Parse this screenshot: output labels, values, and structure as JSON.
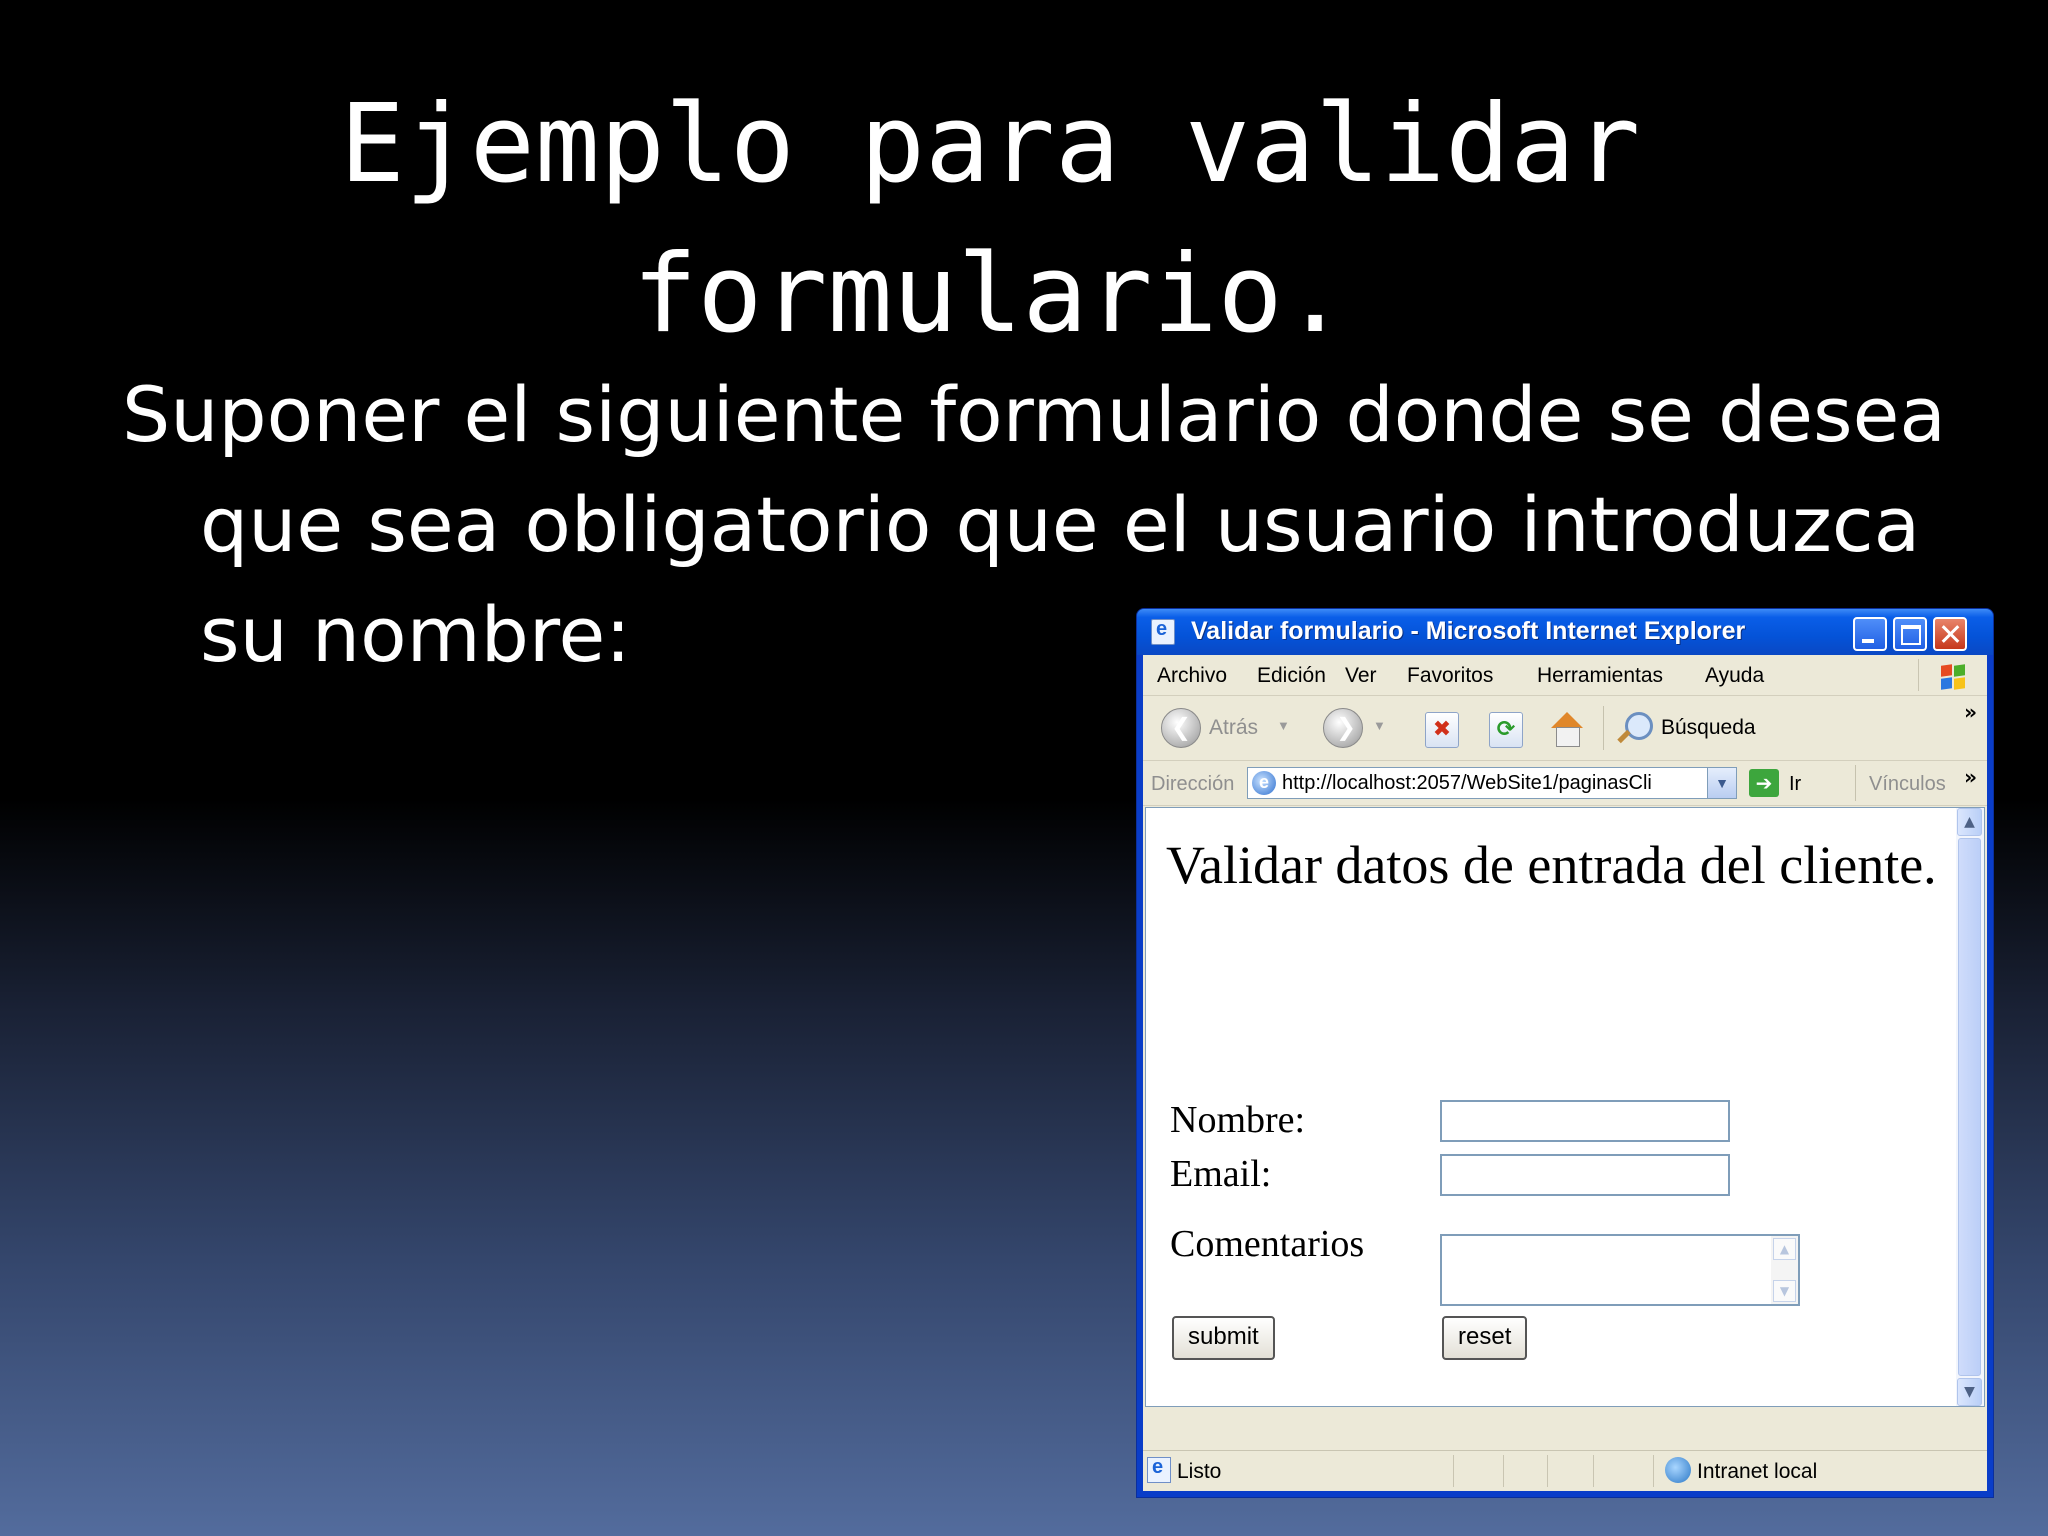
{
  "slide": {
    "title_line1": "Ejemplo para validar",
    "title_line2": "formulario.",
    "body_line1": "Suponer el siguiente formulario donde se desea",
    "body_line2": "que sea obligatorio que el usuario introduzca",
    "body_line3": "su nombre:"
  },
  "browser": {
    "title": "Validar formulario - Microsoft Internet Explorer",
    "menu": [
      "Archivo",
      "Edición",
      "Ver",
      "Favoritos",
      "Herramientas",
      "Ayuda"
    ],
    "toolbar": {
      "back_label": "Atrás",
      "search_label": "Búsqueda",
      "overflow": "»"
    },
    "address": {
      "label": "Dirección",
      "url": "http://localhost:2057/WebSite1/paginasCli",
      "go_label": "Ir",
      "links_label": "Vínculos",
      "overflow": "»"
    },
    "status": {
      "text": "Listo",
      "zone": "Intranet local"
    },
    "icons": {
      "title": "ie-page-icon",
      "back": "back-arrow-icon",
      "forward": "forward-arrow-icon",
      "stop": "stop-icon",
      "refresh": "refresh-icon",
      "home": "home-icon",
      "search": "magnifier-icon",
      "go": "go-arrow-icon",
      "zone": "intranet-globe-icon",
      "windows": "windows-flag-icon"
    }
  },
  "page": {
    "heading": "Validar datos de entrada del cliente.",
    "labels": {
      "nombre": "Nombre:",
      "email": "Email:",
      "comentarios": "Comentarios"
    },
    "values": {
      "nombre": "",
      "email": "",
      "comentarios": ""
    },
    "buttons": {
      "submit": "submit",
      "reset": "reset"
    }
  }
}
